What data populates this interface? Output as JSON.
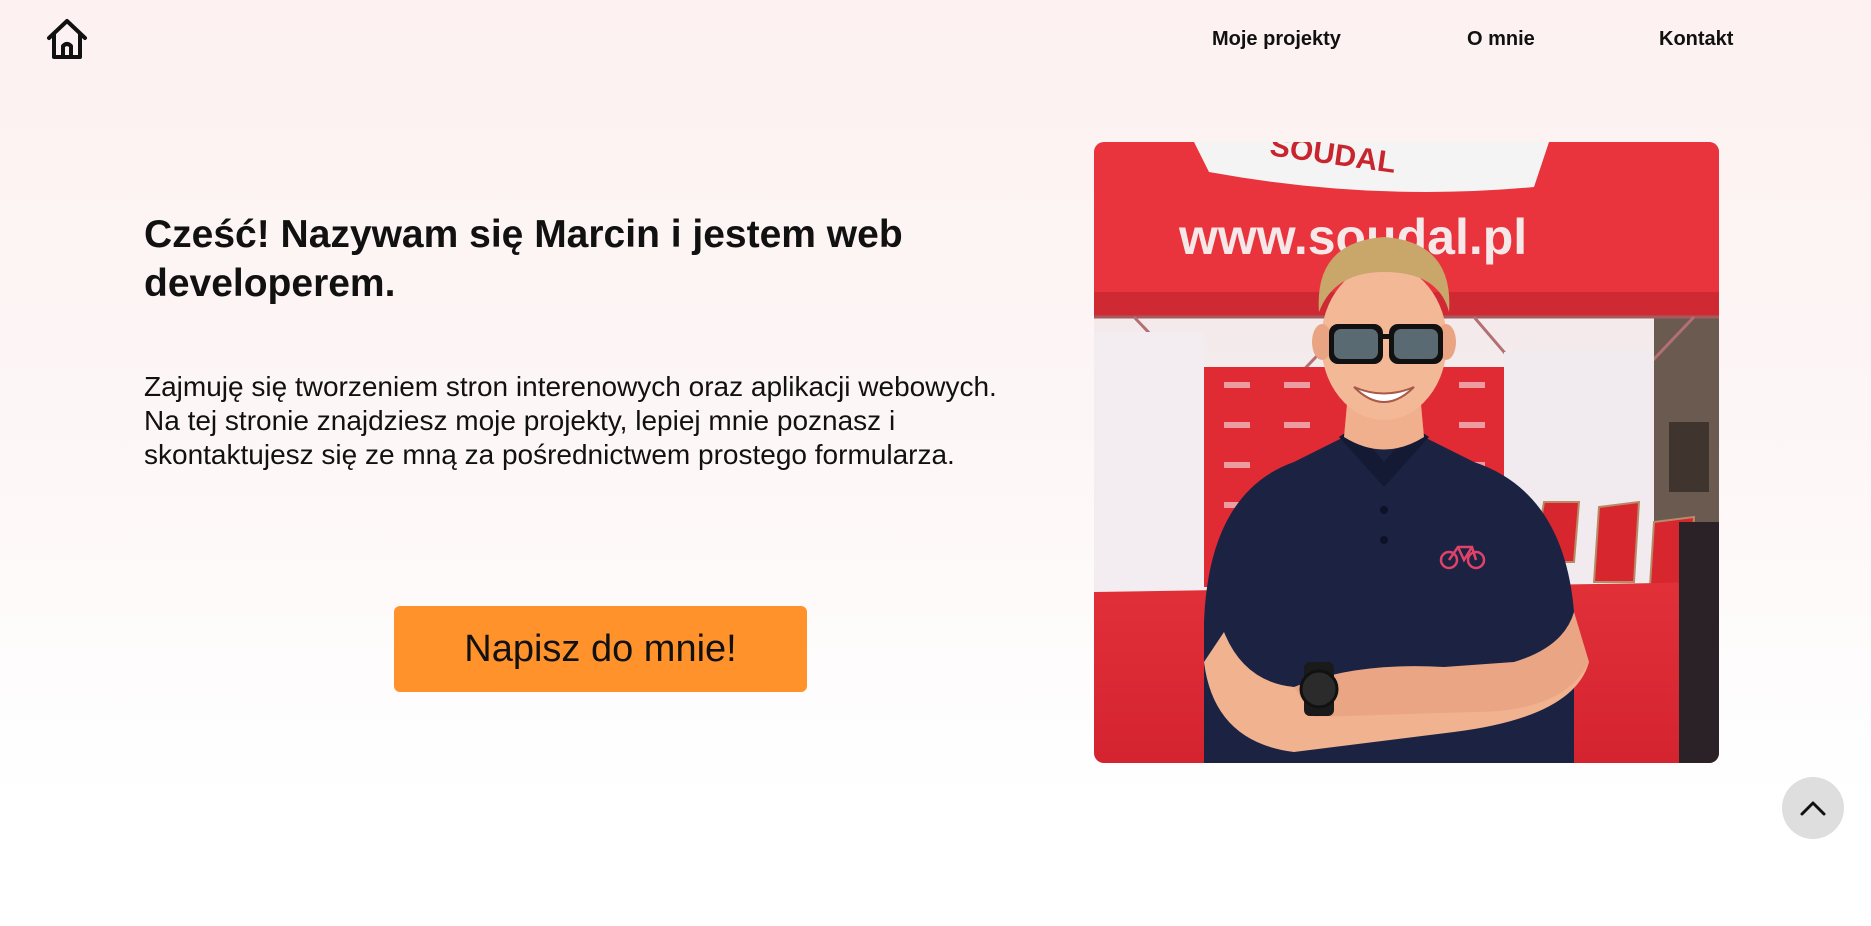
{
  "nav": {
    "home_icon": "home-icon",
    "links": [
      {
        "label": "Moje projekty"
      },
      {
        "label": "O mnie"
      },
      {
        "label": "Kontakt"
      }
    ]
  },
  "hero": {
    "title": "Cześć! Nazywam się Marcin i jestem web developerem.",
    "description": "Zajmuję się tworzeniem stron interenowych oraz aplikacji webowych. Na tej stronie znajdziesz moje projekty, lepiej mnie poznasz i skontaktujesz się ze mną za pośrednictwem prostego formularza.",
    "cta_label": "Napisz do mnie!",
    "photo_banner_text": "www.soudal.pl",
    "photo_brand_text": "SOUDAL"
  },
  "scroll_top_icon": "chevron-up-icon",
  "colors": {
    "accent": "#ff922b",
    "text": "#111111",
    "background_top": "#fdf1f1",
    "tent_red": "#e8333c",
    "scroll_button": "#dedede"
  }
}
